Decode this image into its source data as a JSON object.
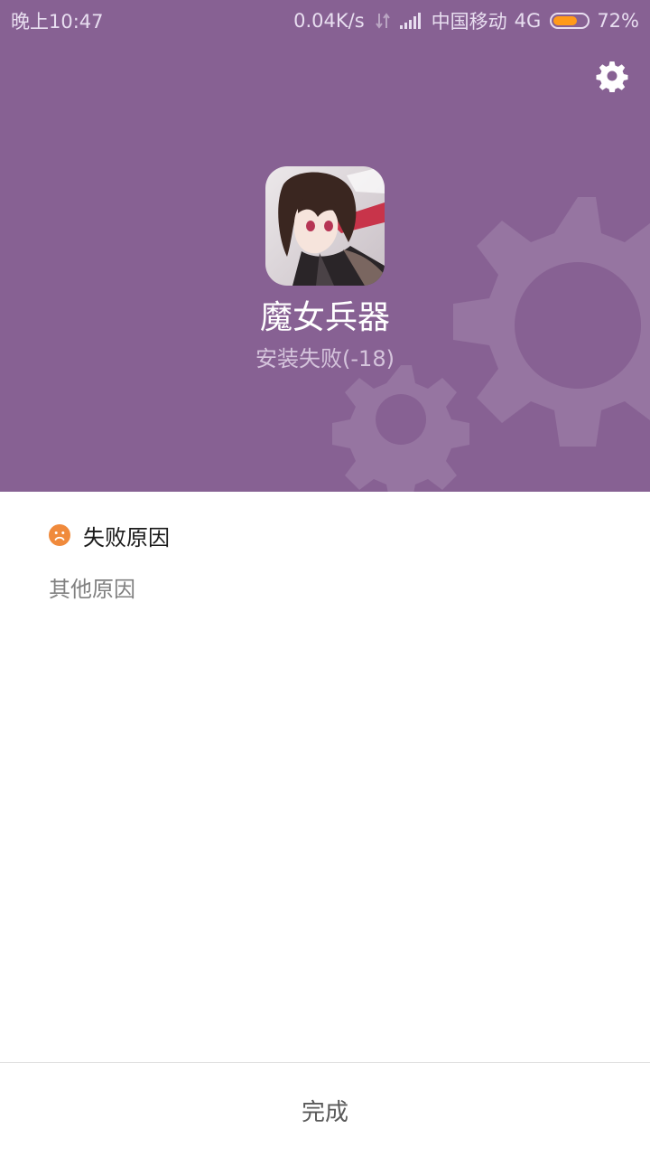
{
  "status_bar": {
    "time": "晚上10:47",
    "net_speed": "0.04K/s",
    "carrier": "中国移动",
    "network_type": "4G",
    "battery_percent_label": "72%",
    "battery_level": 0.72,
    "battery_color": "#ff9a1a"
  },
  "header": {
    "background_color": "#876193",
    "settings_icon": "gear-icon",
    "app_name": "魔女兵器",
    "install_status": "安装失败(-18)"
  },
  "failure": {
    "title_icon": "sad-face-icon",
    "title_icon_color": "#f08a3c",
    "title": "失败原因",
    "reason": "其他原因"
  },
  "footer": {
    "done_label": "完成"
  }
}
